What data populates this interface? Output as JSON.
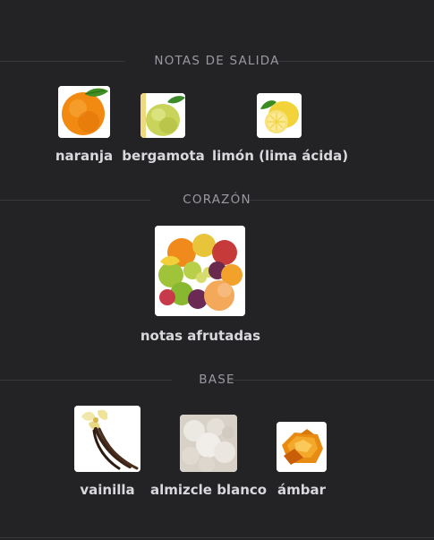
{
  "sections": {
    "top": {
      "title": "NOTAS DE SALIDA",
      "items": [
        {
          "name": "naranja",
          "icon": "orange-icon"
        },
        {
          "name": "bergamota",
          "icon": "bergamot-icon"
        },
        {
          "name": "limón (lima ácida)",
          "icon": "lemon-icon"
        }
      ]
    },
    "heart": {
      "title": "CORAZÓN",
      "items": [
        {
          "name": "notas afrutadas",
          "icon": "mixed-fruits-icon"
        }
      ]
    },
    "base": {
      "title": "BASE",
      "items": [
        {
          "name": "vainilla",
          "icon": "vanilla-icon"
        },
        {
          "name": "almizcle blanco",
          "icon": "white-musk-icon"
        },
        {
          "name": "ámbar",
          "icon": "amber-icon"
        }
      ]
    }
  }
}
